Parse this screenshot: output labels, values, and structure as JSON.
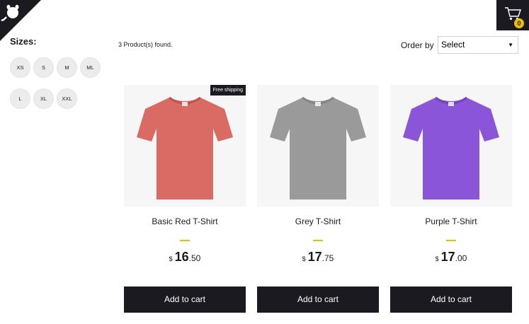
{
  "filters": {
    "title": "Sizes:",
    "sizes": [
      "XS",
      "S",
      "M",
      "ML",
      "L",
      "XL",
      "XXL"
    ]
  },
  "cart": {
    "count": "0",
    "icon": "cart-icon"
  },
  "shelf": {
    "products_found": "3 Product(s) found.",
    "order_label": "Order by",
    "order_selected": "Select"
  },
  "products": [
    {
      "title": "Basic Red T-Shirt",
      "currency": "$",
      "price_int": "16",
      "price_dec": ".50",
      "badge": "Free shipping",
      "color": "#d96a64",
      "button": "Add to cart"
    },
    {
      "title": "Grey T-Shirt",
      "currency": "$",
      "price_int": "17",
      "price_dec": ".75",
      "badge": "",
      "color": "#9a9a9a",
      "button": "Add to cart"
    },
    {
      "title": "Purple T-Shirt",
      "currency": "$",
      "price_int": "17",
      "price_dec": ".00",
      "badge": "",
      "color": "#8a55d8",
      "button": "Add to cart"
    }
  ],
  "colors": {
    "dark": "#1b1a20",
    "accent": "#eabf00"
  }
}
